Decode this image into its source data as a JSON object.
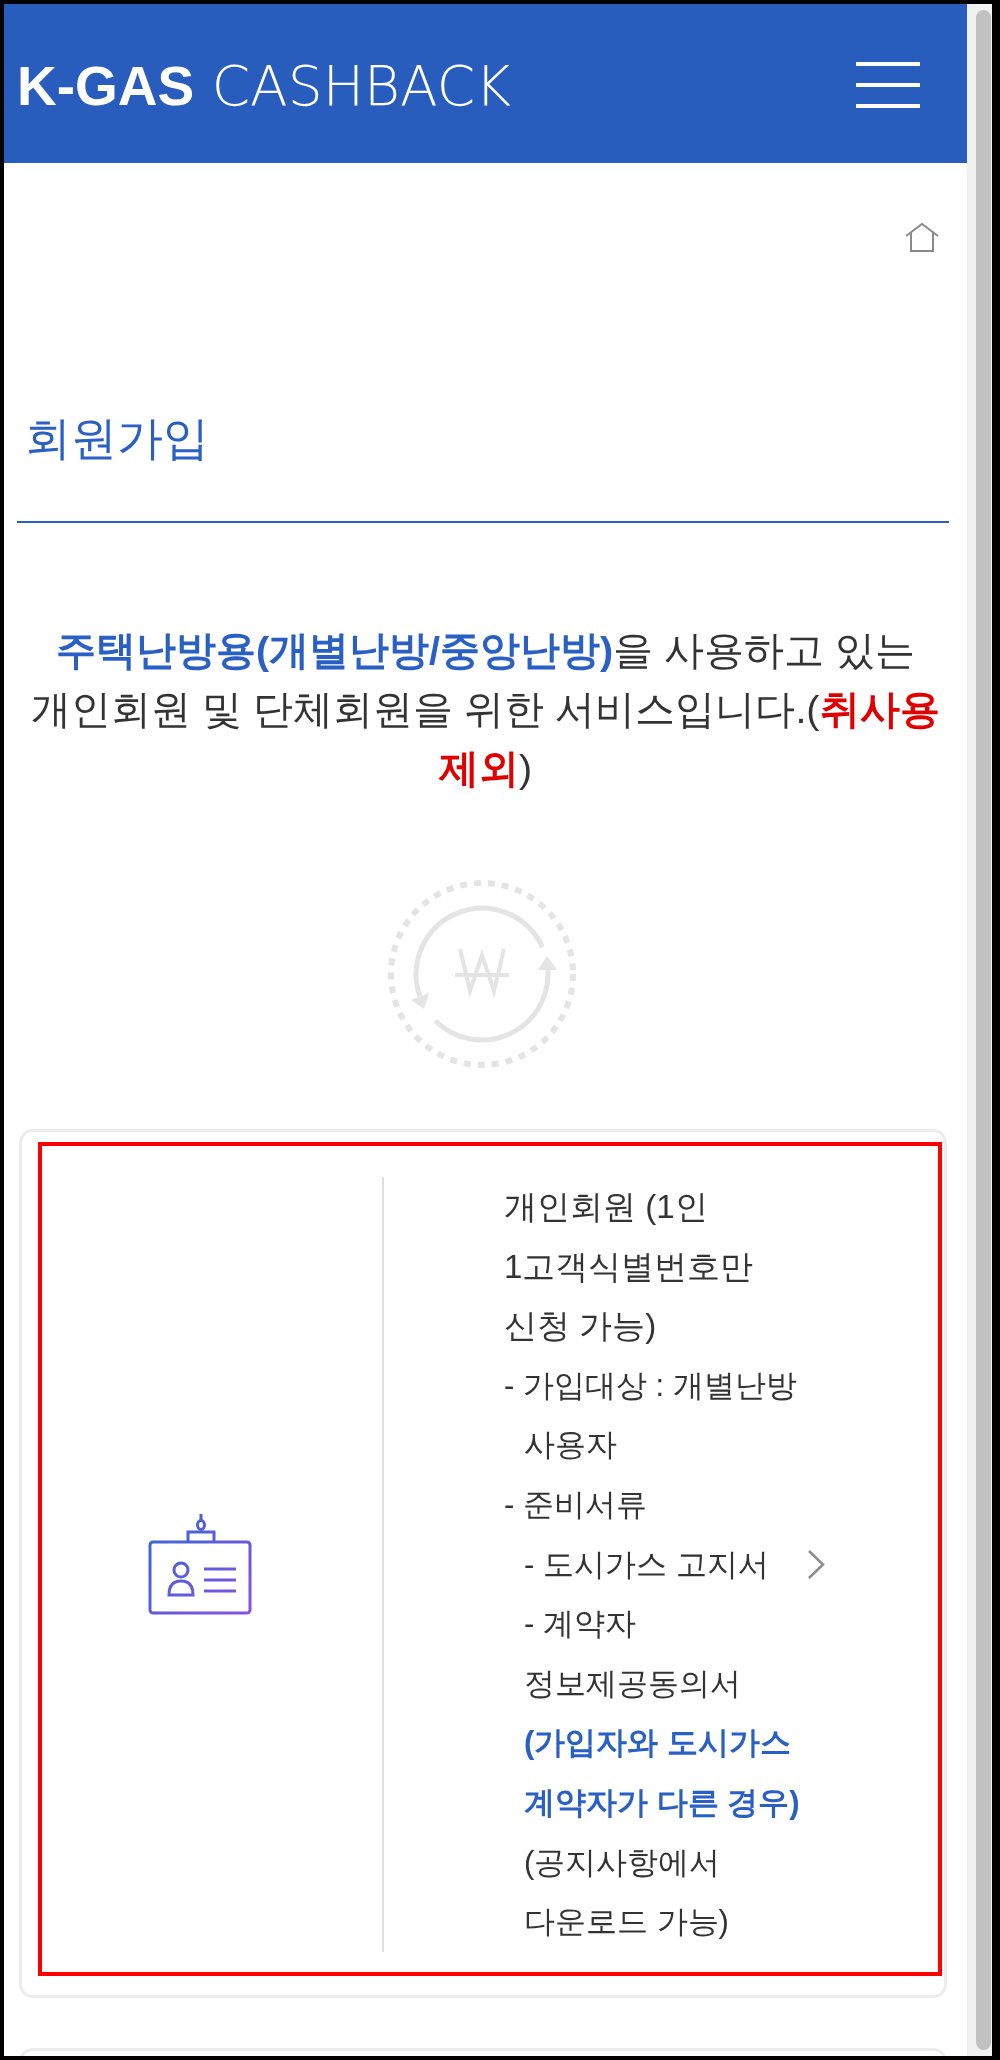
{
  "header": {
    "logo": "**K-GAS** CASHBACK"
  },
  "page": {
    "title": "회원가입"
  },
  "intro": {
    "segments": [
      {
        "kind": "highlight",
        "text": "주택난방용(개별난방/중앙난방)"
      },
      {
        "kind": "plain",
        "text": "을 사용하고 있는 개인회원 및 단체회원을 위한 서비스입니다.("
      },
      {
        "kind": "warning",
        "text": "취사용 제외"
      },
      {
        "kind": "plain",
        "text": ")"
      }
    ]
  },
  "cards": [
    {
      "title": "개인회원 (1인 1고객식별번호만 신청 가능)",
      "highlighted": true,
      "items": [
        {
          "segments": [
            {
              "kind": "plain",
              "text": "- 가입대상 : 개별난방 사용자"
            }
          ]
        },
        {
          "segments": [
            {
              "kind": "plain",
              "text": "- 준비서류"
            }
          ],
          "children": [
            {
              "segments": [
                {
                  "kind": "plain",
                  "text": "- 도시가스 고지서"
                }
              ]
            },
            {
              "segments": [
                {
                  "kind": "plain",
                  "text": "- 계약자 정보제공동의서 "
                },
                {
                  "kind": "highlight",
                  "text": "(가입자와 도시가스 계약자가 다른 경우)"
                },
                {
                  "kind": "plain",
                  "text": " (공지사항에서 다운로드 가능)"
                }
              ]
            }
          ]
        }
      ]
    }
  ]
}
